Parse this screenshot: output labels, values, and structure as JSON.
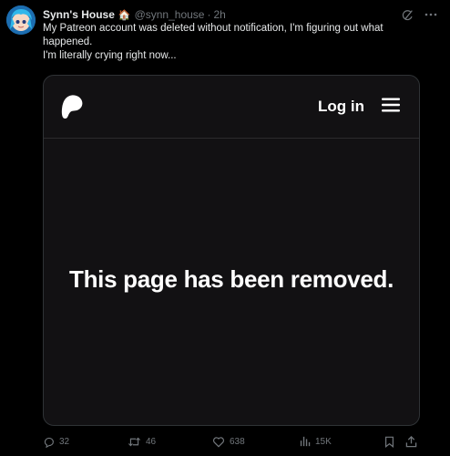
{
  "tweet": {
    "author_name": "Synn's House",
    "name_emoji": "🏠",
    "handle": "@synn_house",
    "separator": "·",
    "time": "2h",
    "text_line1": "My Patreon account was deleted without notification, I'm figuring out what happened.",
    "text_line2": "I'm literally crying right now..."
  },
  "card": {
    "login_label": "Log in",
    "message": "This page has been removed.",
    "logo_icon": "patreon-logo-icon",
    "menu_icon": "hamburger-menu-icon"
  },
  "actions": {
    "replies": "32",
    "reposts": "46",
    "likes": "638",
    "views": "15K"
  },
  "colors": {
    "background": "#000000",
    "muted": "#71767b",
    "text": "#e7e9ea",
    "card_bg": "#121113",
    "border": "#2f3336"
  }
}
